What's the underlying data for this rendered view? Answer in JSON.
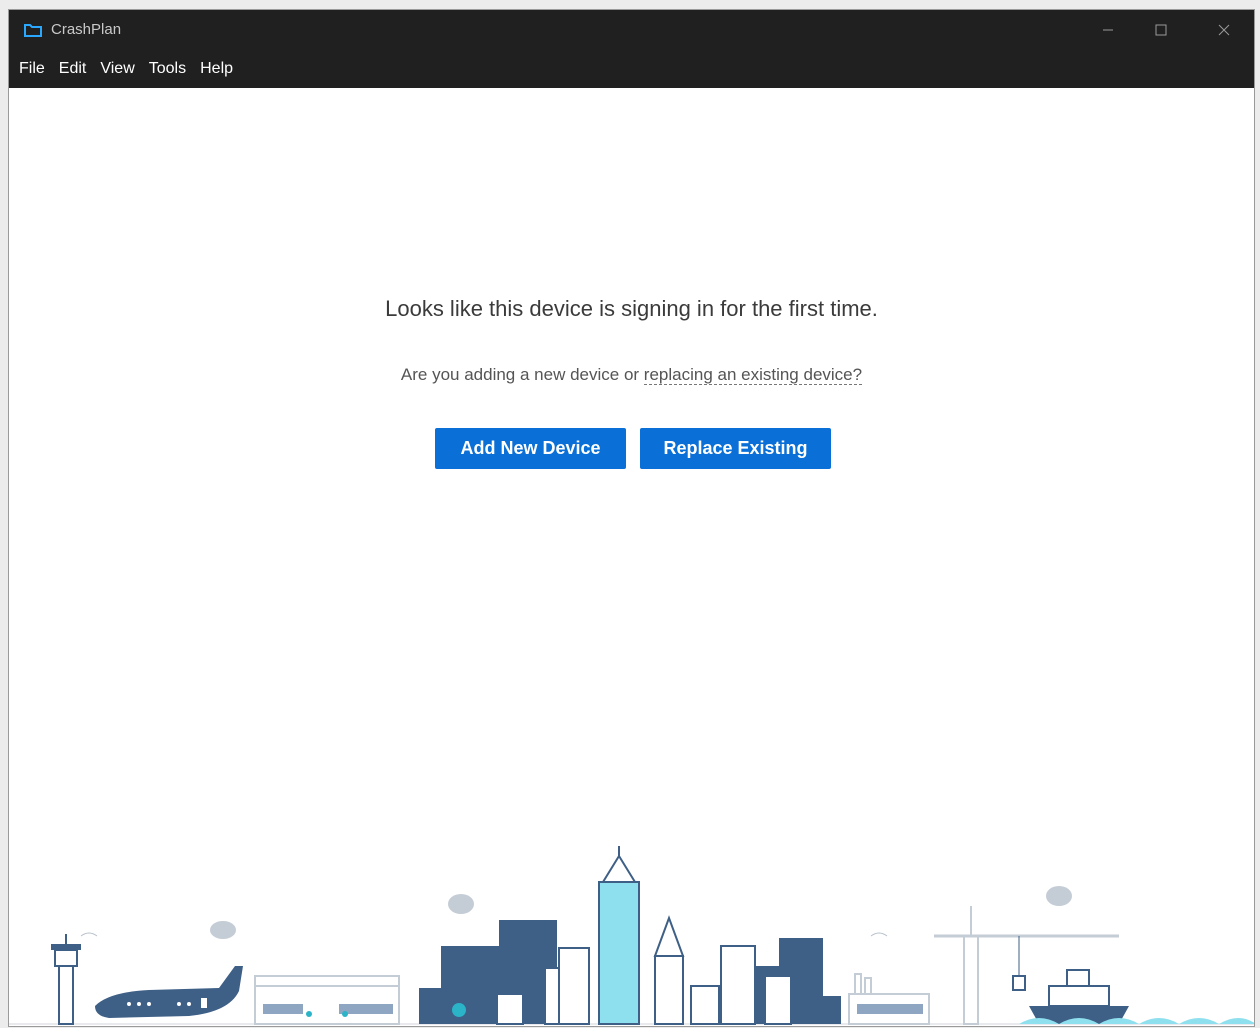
{
  "window": {
    "title": "CrashPlan"
  },
  "menu": {
    "items": [
      "File",
      "Edit",
      "View",
      "Tools",
      "Help"
    ]
  },
  "main": {
    "headline": "Looks like this device is signing in for the first time.",
    "question_prefix": "Are you adding a new device or ",
    "question_link": "replacing an existing device?",
    "add_button": "Add New Device",
    "replace_button": "Replace Existing"
  },
  "icons": {
    "app": "folder-icon",
    "minimize": "minimize-icon",
    "maximize": "maximize-icon",
    "close": "close-icon"
  },
  "colors": {
    "titlebar": "#202020",
    "accent": "#0a6fd6",
    "skyline_dark": "#3e5f86",
    "skyline_light": "#8ee0ee",
    "cloud": "#c4ccd6"
  }
}
